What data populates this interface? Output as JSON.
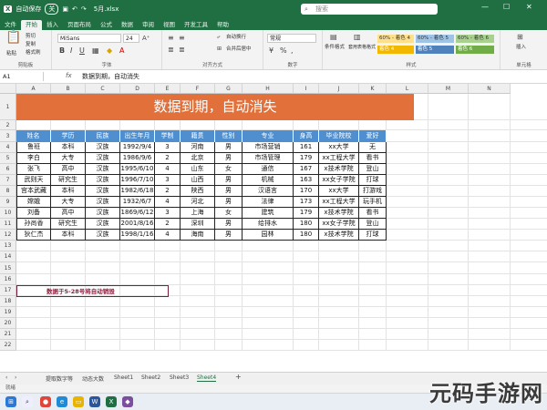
{
  "titlebar": {
    "autosave": "自动保存",
    "toggle": "关",
    "filename": "5月.xlsx",
    "search_placeholder": "搜索"
  },
  "menu": [
    "文件",
    "开始",
    "插入",
    "页面布局",
    "公式",
    "数据",
    "审阅",
    "视图",
    "开发工具",
    "帮助"
  ],
  "ribbon": {
    "paste": "粘贴",
    "cut": "剪切",
    "copy": "复制",
    "format_painter": "格式刷",
    "clipboard": "剪贴板",
    "font_name": "MiSans",
    "font_size": "24",
    "font_group": "字体",
    "wrap": "自动换行",
    "merge": "合并后居中",
    "align_group": "对齐方式",
    "number_format": "常规",
    "number_group": "数字",
    "cond_format": "条件格式",
    "table_format": "套用表格格式",
    "styles_group": "样式",
    "insert": "插入",
    "cells_group": "单元格",
    "styles": [
      "60% - 着色 4",
      "60% - 着色 5",
      "60% - 着色 6",
      "着色 4",
      "着色 5",
      "着色 6"
    ]
  },
  "formula": {
    "name_box": "A1",
    "fx": "fx",
    "value": "数据到期，自动消失"
  },
  "columns": [
    "A",
    "B",
    "C",
    "D",
    "E",
    "F",
    "G",
    "H",
    "I",
    "J",
    "K",
    "L",
    "M",
    "N"
  ],
  "rows": [
    "1",
    "2",
    "3",
    "4",
    "5",
    "6",
    "7",
    "8",
    "9",
    "10",
    "11",
    "12",
    "13",
    "14",
    "15",
    "16",
    "17",
    "18",
    "19",
    "20",
    "21",
    "22"
  ],
  "sheet_title": "数据到期，自动消失",
  "headers": [
    "姓名",
    "学历",
    "民族",
    "出生年月",
    "学制",
    "籍贯",
    "性别",
    "专业",
    "身高",
    "毕业院校",
    "爱好"
  ],
  "records": [
    [
      "鲁班",
      "本科",
      "汉族",
      "1992/9/4",
      "3",
      "河南",
      "男",
      "市场营销",
      "161",
      "xx大学",
      "无"
    ],
    [
      "李白",
      "大专",
      "汉族",
      "1986/9/6",
      "2",
      "北京",
      "男",
      "市场管理",
      "179",
      "xx工程大学",
      "看书"
    ],
    [
      "张飞",
      "高中",
      "汉族",
      "1995/6/10",
      "4",
      "山东",
      "女",
      "通信",
      "167",
      "x技术学院",
      "登山"
    ],
    [
      "武则天",
      "研究生",
      "汉族",
      "1996/7/10",
      "3",
      "山西",
      "男",
      "机械",
      "163",
      "xx女子学院",
      "打球"
    ],
    [
      "宫本武藏",
      "本科",
      "汉族",
      "1982/6/18",
      "2",
      "陕西",
      "男",
      "汉语言",
      "170",
      "xx大学",
      "打游戏"
    ],
    [
      "嫦娥",
      "大专",
      "汉族",
      "1932/6/7",
      "4",
      "河北",
      "男",
      "法律",
      "173",
      "xx工程大学",
      "玩手机"
    ],
    [
      "刘备",
      "高中",
      "汉族",
      "1869/6/12",
      "3",
      "上海",
      "女",
      "建筑",
      "179",
      "x技术学院",
      "看书"
    ],
    [
      "孙尚香",
      "研究生",
      "汉族",
      "2001/8/16",
      "2",
      "深圳",
      "男",
      "给排水",
      "180",
      "xx女子学院",
      "登山"
    ],
    [
      "狄仁杰",
      "本科",
      "汉族",
      "1998/1/16",
      "4",
      "海南",
      "男",
      "园林",
      "180",
      "x技术学院",
      "打球"
    ]
  ],
  "note": "数据于5-28号将自动销毁",
  "sheets": [
    "提取数字等",
    "动态大数",
    "Sheet1",
    "Sheet2",
    "Sheet3",
    "Sheet4"
  ],
  "active_sheet": "Sheet4",
  "status": "就绪",
  "watermark": "元码手游网",
  "colors": {
    "excel_green": "#1f6f43",
    "title_orange": "#e2703a",
    "header_blue": "#4f8fcf",
    "note_red": "#8b2040"
  }
}
